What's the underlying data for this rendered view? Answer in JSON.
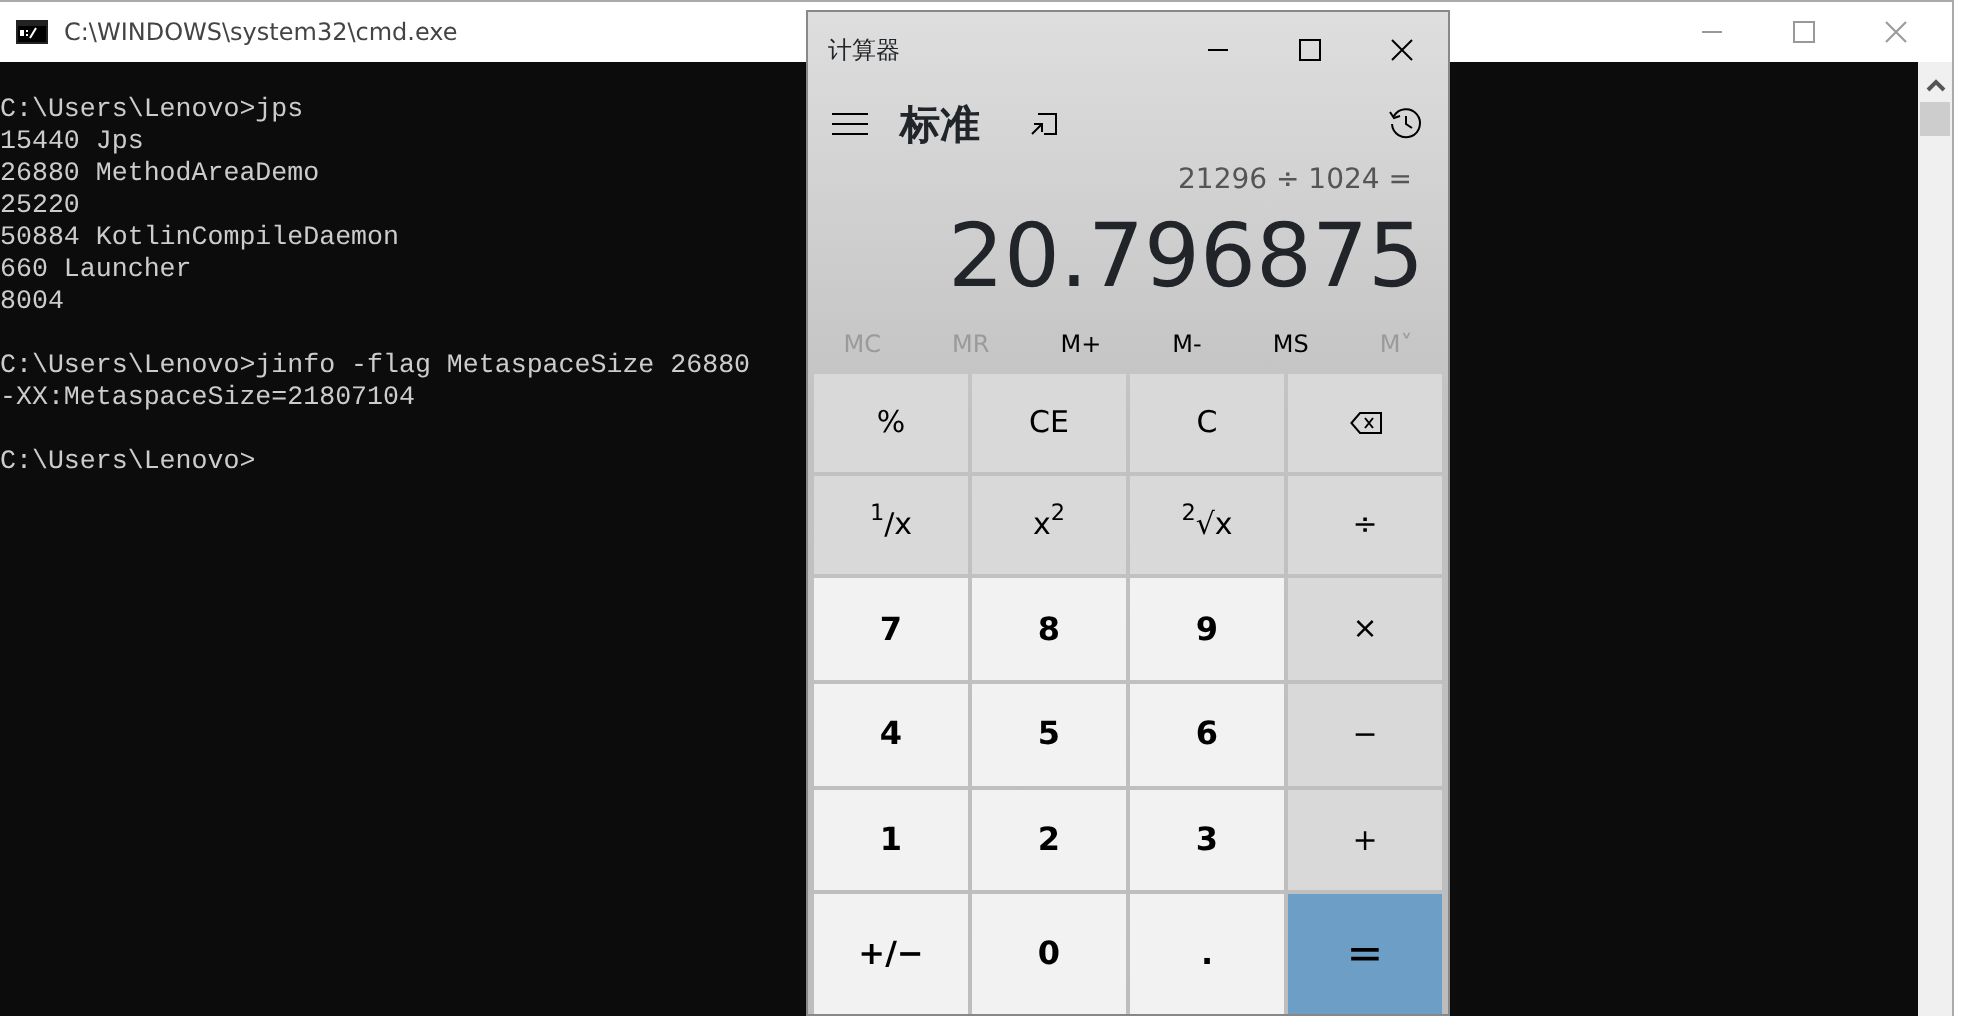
{
  "console_window": {
    "title": "C:\\WINDOWS\\system32\\cmd.exe",
    "blocks": [
      [
        "C:\\Users\\Lenovo>jps",
        "15440 Jps",
        "26880 MethodAreaDemo",
        "25220",
        "50884 KotlinCompileDaemon",
        "660 Launcher",
        "8004"
      ],
      [
        "C:\\Users\\Lenovo>jinfo -flag MetaspaceSize 26880",
        "-XX:MetaspaceSize=21807104"
      ],
      [
        "C:\\Users\\Lenovo>"
      ]
    ]
  },
  "calculator": {
    "title": "计算器",
    "mode": "标准",
    "expression": "21296 ÷ 1024 =",
    "result": "20.796875",
    "memory": [
      {
        "label": "MC",
        "disabled": true
      },
      {
        "label": "MR",
        "disabled": true
      },
      {
        "label": "M+",
        "disabled": false
      },
      {
        "label": "M-",
        "disabled": false
      },
      {
        "label": "MS",
        "disabled": false
      },
      {
        "label": "M˅",
        "disabled": true
      }
    ],
    "keys": [
      {
        "label": "%",
        "kind": "op"
      },
      {
        "label": "CE",
        "kind": "op"
      },
      {
        "label": "C",
        "kind": "op"
      },
      {
        "kind": "backspace"
      },
      {
        "label": "$^{1}$/x",
        "kind": "op"
      },
      {
        "label": "x$^{2}$",
        "kind": "op"
      },
      {
        "label": "$^{2}$√x",
        "kind": "op"
      },
      {
        "label": "÷",
        "kind": "op"
      },
      {
        "label": "7",
        "kind": "num"
      },
      {
        "label": "8",
        "kind": "num"
      },
      {
        "label": "9",
        "kind": "num"
      },
      {
        "label": "×",
        "kind": "op"
      },
      {
        "label": "4",
        "kind": "num"
      },
      {
        "label": "5",
        "kind": "num"
      },
      {
        "label": "6",
        "kind": "num"
      },
      {
        "label": "−",
        "kind": "op"
      },
      {
        "label": "1",
        "kind": "num"
      },
      {
        "label": "2",
        "kind": "num"
      },
      {
        "label": "3",
        "kind": "num"
      },
      {
        "label": "+",
        "kind": "op"
      },
      {
        "label": "+/−",
        "kind": "num"
      },
      {
        "label": "0",
        "kind": "num"
      },
      {
        "label": ".",
        "kind": "num"
      },
      {
        "label": "=",
        "kind": "equals"
      }
    ]
  }
}
